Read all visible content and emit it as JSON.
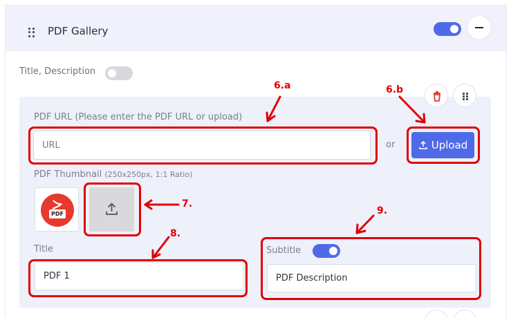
{
  "header": {
    "title": "PDF Gallery",
    "toggle_on": true
  },
  "title_description": {
    "label": "Title, Description",
    "toggle_on": false
  },
  "pdf_url": {
    "label": "PDF URL (Please enter the PDF URL or upload)",
    "placeholder": "URL",
    "or_text": "or",
    "upload_label": "Upload"
  },
  "thumbnail": {
    "label": "PDF Thumbnail",
    "hint": "(250x250px, 1:1 Ratio)",
    "badge": "PDF"
  },
  "title_field": {
    "label": "Title",
    "value": "PDF 1"
  },
  "subtitle_field": {
    "label": "Subtitle",
    "toggle_on": true,
    "value": "PDF Description"
  },
  "annotations": {
    "a6a": "6.a",
    "a6b": "6.b",
    "a7": "7.",
    "a8": "8.",
    "a9": "9."
  },
  "colors": {
    "accent": "#4f6ae8",
    "annotation": "#e00000",
    "card_bg": "#eef0fa",
    "pdf_red": "#e63a2f"
  },
  "icons": [
    "drag-handle-icon",
    "minus-icon",
    "trash-icon",
    "drag-handle-icon",
    "upload-icon",
    "pdf-icon"
  ]
}
